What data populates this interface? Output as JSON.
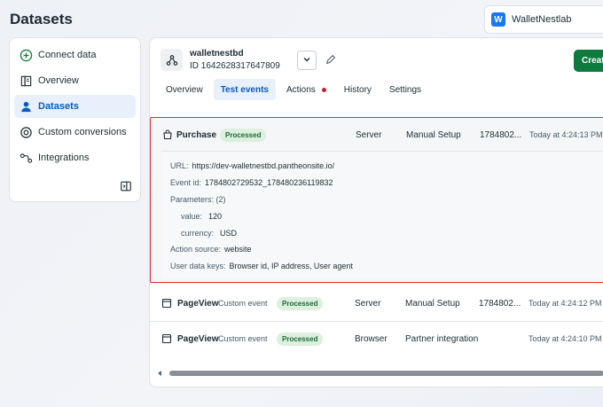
{
  "page": {
    "title": "Datasets"
  },
  "account": {
    "initial": "W",
    "name": "WalletNestlab"
  },
  "sidebar": {
    "items": [
      {
        "label": "Connect data",
        "icon": "plus-circle-icon"
      },
      {
        "label": "Overview",
        "icon": "book-icon"
      },
      {
        "label": "Datasets",
        "icon": "people-icon",
        "active": true
      },
      {
        "label": "Custom conversions",
        "icon": "badge-icon"
      },
      {
        "label": "Integrations",
        "icon": "nodes-icon"
      }
    ]
  },
  "dataset": {
    "name": "walletnestbd",
    "id_label": "ID 1642628317647809",
    "create_label": "Creat"
  },
  "tabs": [
    {
      "label": "Overview"
    },
    {
      "label": "Test events",
      "active": true
    },
    {
      "label": "Actions",
      "alert_dot": true
    },
    {
      "label": "History"
    },
    {
      "label": "Settings"
    }
  ],
  "events": [
    {
      "name": "Purchase",
      "type": "",
      "status": "Processed",
      "source": "Server",
      "setup": "Manual Setup",
      "event_id_short": "1784802...",
      "time": "Today at 4:24:13 PM",
      "expanded": true,
      "details": {
        "url_label": "URL:",
        "url_value": "https://dev-walletnestbd.pantheonsite.io/",
        "event_id_label": "Event id:",
        "event_id_value": "1784802729532_178480236119832",
        "params_label": "Parameters: (2)",
        "param_value_label": "value:",
        "param_value_value": "120",
        "param_currency_label": "currency:",
        "param_currency_value": "USD",
        "action_source_label": "Action source:",
        "action_source_value": "website",
        "user_keys_label": "User data keys:",
        "user_keys_value": "Browser id, IP address, User agent"
      }
    },
    {
      "name": "PageView",
      "type": "Custom event",
      "status": "Processed",
      "source": "Server",
      "setup": "Manual Setup",
      "event_id_short": "1784802...",
      "time": "Today at 4:24:12 PM"
    },
    {
      "name": "PageView",
      "type": "Custom event",
      "status": "Processed",
      "source": "Browser",
      "setup": "Partner integration",
      "event_id_short": "",
      "time": "Today at 4:24:10 PM"
    }
  ],
  "colors": {
    "accent": "#0a5bc2",
    "active_bg": "#e7f0fb",
    "badge_bg": "#ddefdf",
    "badge_text": "#1b6b37",
    "highlight_border": "#e42d2d",
    "create_button": "#0f7a3e"
  }
}
